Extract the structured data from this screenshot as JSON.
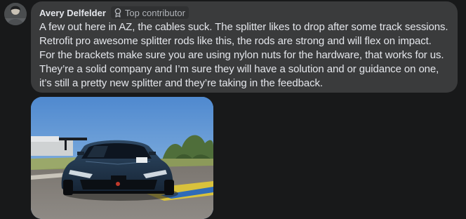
{
  "comment": {
    "author": "Avery Delfelder",
    "badge_label": "Top contributor",
    "badge_icon": "award-ribbon-icon",
    "text": "A few out here in AZ, the cables suck. The splitter likes to drop after some track sessions. Retrofit pro awesome splitter rods like this, the rods are strong and will flex on impact. For the brackets make sure you are using nylon nuts for the hardware, that works for us. They’re a solid company and I’m sure they will have a solution and or guidance on one, it’s still a pretty new splitter and they’re taking in the feedback.",
    "attachment": "photo of dark blue sports car on race track"
  },
  "colors": {
    "page_background": "#18191a",
    "bubble_background": "#3a3b3c",
    "text_primary": "#e4e6eb",
    "text_secondary": "#b0b3b8"
  }
}
